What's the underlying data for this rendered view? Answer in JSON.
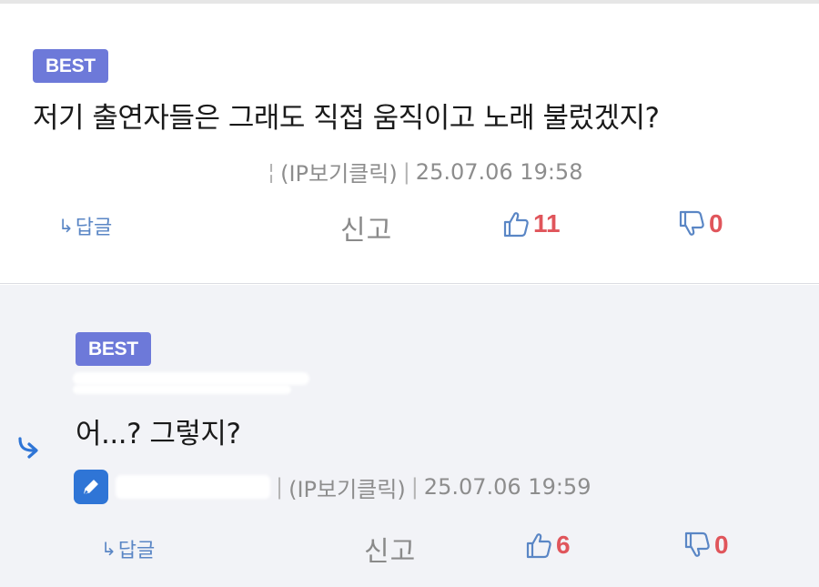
{
  "comments": [
    {
      "badge": "BEST",
      "text": "저기 출연자들은 그래도 직접 움직이고 노래 불렀겠지?",
      "ip_label": "(IP보기클릭)",
      "datetime": "25.07.06 19:58",
      "reply_label": "답글",
      "report_label": "신고",
      "likes": "11",
      "dislikes": "0"
    },
    {
      "badge": "BEST",
      "text": "어...? 그렇지?",
      "ip_label": "(IP보기클릭)",
      "datetime": "25.07.06 19:59",
      "reply_label": "답글",
      "report_label": "신고",
      "likes": "6",
      "dislikes": "0"
    }
  ],
  "colors": {
    "badge": "#6d79d9",
    "accent_blue": "#2f75d6",
    "vote_red": "#e0555b",
    "reply_background": "#f2f3f7"
  }
}
